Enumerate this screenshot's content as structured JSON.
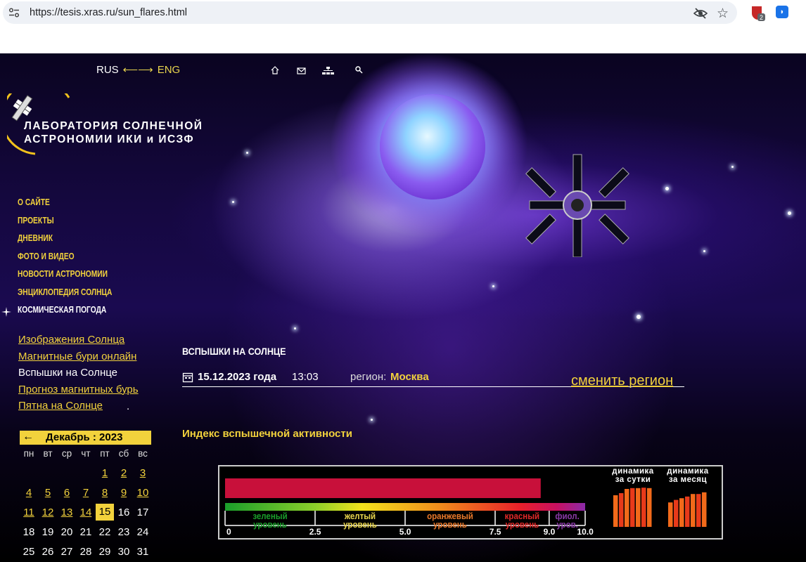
{
  "browser": {
    "url": "https://tesis.xras.ru/sun_flares.html",
    "ext_badge": "2"
  },
  "header": {
    "lang_ru": "RUS",
    "lang_arrow": "⟵⟶",
    "lang_en": "ENG",
    "logo_line1": "ЛАБОРАТОРИЯ СОЛНЕЧНОЙ",
    "logo_line2": "АСТРОНОМИИ ИКИ и ИСЗФ"
  },
  "nav": {
    "items": [
      {
        "label": "О САЙТЕ"
      },
      {
        "label": "ПРОЕКТЫ"
      },
      {
        "label": "ДНЕВНИК"
      },
      {
        "label": "ФОТО И ВИДЕО"
      },
      {
        "label": "НОВОСТИ АСТРОНОМИИ"
      },
      {
        "label": "ЭНЦИКЛОПЕДИЯ СОЛНЦА"
      },
      {
        "label": "КОСМИЧЕСКАЯ ПОГОДА"
      }
    ]
  },
  "sublinks": {
    "items": [
      {
        "label": "Изображения Солнца"
      },
      {
        "label": "Магнитные бури онлайн"
      },
      {
        "label": "Вспышки на Солнце"
      },
      {
        "label": "Прогноз магнитных бурь"
      },
      {
        "label": "Пятна на Солнце"
      }
    ],
    "trailing_dot": "."
  },
  "calendar": {
    "prev": "←",
    "title": "Декабрь : 2023",
    "dow": [
      "пн",
      "вт",
      "ср",
      "чт",
      "пт",
      "сб",
      "вс"
    ],
    "rows": [
      [
        "",
        "",
        "",
        "",
        "1",
        "2",
        "3"
      ],
      [
        "4",
        "5",
        "6",
        "7",
        "8",
        "9",
        "10"
      ],
      [
        "11",
        "12",
        "13",
        "14",
        "15",
        "16",
        "17"
      ],
      [
        "18",
        "19",
        "20",
        "21",
        "22",
        "23",
        "24"
      ],
      [
        "25",
        "26",
        "27",
        "28",
        "29",
        "30",
        "31"
      ]
    ],
    "today": "15"
  },
  "content": {
    "title": "ВСПЫШКИ НА СОЛНЦЕ",
    "date": "15.12.2023 года",
    "time": "13:03",
    "region_label": "регион:",
    "region_value": "Москва",
    "change_region": "сменить регион",
    "index_title": "Индекс вспышечной активности"
  },
  "chart_data": {
    "type": "bar",
    "value": 9.0,
    "range": [
      0,
      10
    ],
    "ticks": [
      "0",
      "2.5",
      "5.0",
      "7.5",
      "9.0",
      "10.0"
    ],
    "levels": [
      {
        "line1": "зеленый",
        "line2": "уровень",
        "color": "#1a9e2a"
      },
      {
        "line1": "желтый",
        "line2": "уровень",
        "color": "#e8d44d"
      },
      {
        "line1": "оранжевый",
        "line2": "уровень",
        "color": "#e8782a"
      },
      {
        "line1": "красный",
        "line2": "уровень",
        "color": "#e02828"
      },
      {
        "line1": "фиол.",
        "line2": "уров.",
        "color": "#8a3aa8"
      }
    ],
    "dynamics_day_label": [
      "динамика",
      "за сутки"
    ],
    "dynamics_month_label": [
      "динамика",
      "за месяц"
    ],
    "dynamics_day": [
      7.5,
      8.0,
      9.0,
      9.2,
      9.2,
      9.3,
      9.2
    ],
    "dynamics_month": [
      5.8,
      6.4,
      6.8,
      7.2,
      7.8,
      7.8,
      8.2
    ],
    "bar_color": "#c8103a"
  }
}
